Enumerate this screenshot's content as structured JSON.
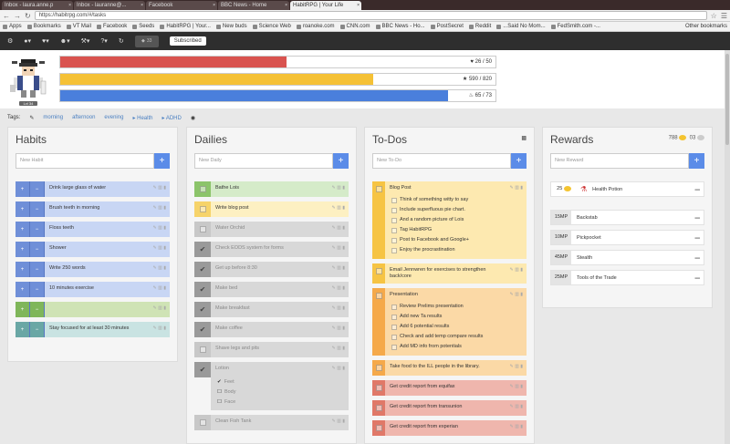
{
  "browser": {
    "tabs": [
      {
        "title": "Inbox - laura.anne.p",
        "active": false
      },
      {
        "title": "Inbox - lauranne@...",
        "active": false
      },
      {
        "title": "Facebook",
        "active": false
      },
      {
        "title": "BBC News - Home",
        "active": false
      },
      {
        "title": "HabitRPG | Your Life",
        "active": true
      }
    ],
    "url": "https://habitrpg.com/#/tasks",
    "bookmarks": [
      "Apps",
      "Bookmarks",
      "VT Mail",
      "Facebook",
      "Seeds",
      "HabitRPG | Your...",
      "New buds",
      "Science Web",
      "roanoke.com",
      "CNN.com",
      "BBC News - Ho...",
      "PostSecret",
      "Reddit",
      "...Said No Mom...",
      "FedSmith.com -..."
    ],
    "other_bookmarks": "Other bookmarks"
  },
  "nav": {
    "gems_label": "33",
    "subscribed_label": "Subscribed"
  },
  "stats": {
    "level_badge": "Lvl 34",
    "health": {
      "label": "26 / 50",
      "value": 26,
      "max": 50,
      "color": "#d9534f"
    },
    "experience": {
      "label": "590 / 820",
      "value": 590,
      "max": 820,
      "color": "#f5c136"
    },
    "mana": {
      "label": "65 / 73",
      "value": 65,
      "max": 73,
      "color": "#4a7fdc"
    }
  },
  "tags": {
    "label": "Tags:",
    "items": [
      "morning",
      "afternoon",
      "evening",
      "Health",
      "ADHD"
    ]
  },
  "habits": {
    "title": "Habits",
    "placeholder": "New Habit",
    "items": [
      {
        "text": "Drink large glass of water",
        "color": "#c8d6f4"
      },
      {
        "text": "Brush teeth in morning",
        "color": "#c8d6f4"
      },
      {
        "text": "Floss teeth",
        "color": "#c8d6f4"
      },
      {
        "text": "Shower",
        "color": "#c8d6f4"
      },
      {
        "text": "Write 250 words",
        "color": "#c8d6f4"
      },
      {
        "text": "10 minutes exercise",
        "color": "#c8d6f4"
      },
      {
        "text": "",
        "color": "#cfe3b5"
      },
      {
        "text": "Stay focused for at least 30 minutes",
        "color": "#c9e3e2"
      }
    ]
  },
  "dailies": {
    "title": "Dailies",
    "placeholder": "New Daily",
    "items": [
      {
        "text": "Bathe Lois",
        "color": "#d5ebc9",
        "done": false
      },
      {
        "text": "Write blog post",
        "color": "#fdf0c2",
        "done": false
      },
      {
        "text": "Water Orchid",
        "color": "#d8d8d8",
        "done": false
      },
      {
        "text": "Check EODS system for forms",
        "color": "#d8d8d8",
        "done": true
      },
      {
        "text": "Get up before 8:30",
        "color": "#d8d8d8",
        "done": true
      },
      {
        "text": "Make bed",
        "color": "#d8d8d8",
        "done": true
      },
      {
        "text": "Make breakfast",
        "color": "#d8d8d8",
        "done": true
      },
      {
        "text": "Make coffee",
        "color": "#d8d8d8",
        "done": true
      },
      {
        "text": "Shave legs and pits",
        "color": "#d8d8d8",
        "done": false
      },
      {
        "text": "Lotion",
        "color": "#d8d8d8",
        "done": true,
        "sub": [
          "Feet",
          "Body",
          "Face"
        ]
      },
      {
        "text": "Clean Fish Tank",
        "color": "#d8d8d8",
        "done": false
      }
    ]
  },
  "todos": {
    "title": "To-Dos",
    "placeholder": "New To-Do",
    "items": [
      {
        "text": "Blog Post",
        "color": "#fde9b0",
        "ctrl": "#f6c444",
        "sub": [
          "Think of something witty to say",
          "Include superfluous pie chart.",
          "And a random picture of Lois",
          "Tag HabitRPG",
          "Post to Facebook and Google+",
          "Enjoy the procrastination"
        ]
      },
      {
        "text": "Email Jennwren for exercises to strengthen back/core",
        "color": "#fde9b0",
        "ctrl": "#f6c444",
        "sub": []
      },
      {
        "text": "Presentation",
        "color": "#fbd9a6",
        "ctrl": "#f5a94a",
        "sub": [
          "Review Prelims presentation",
          "Add new Ta results",
          "Add 6 potential results",
          "Check and add temp compare results",
          "Add MD info from potentials"
        ]
      },
      {
        "text": "Take food to the ILL people in the library.",
        "color": "#fbd9a6",
        "ctrl": "#f5a94a",
        "sub": []
      },
      {
        "text": "Get credit report from equifax",
        "color": "#efb6ad",
        "ctrl": "#e07868",
        "sub": []
      },
      {
        "text": "Get credit report from transunion",
        "color": "#efb6ad",
        "ctrl": "#e07868",
        "sub": []
      },
      {
        "text": "Get credit report from experian",
        "color": "#efb6ad",
        "ctrl": "#e07868",
        "sub": []
      }
    ]
  },
  "rewards": {
    "title": "Rewards",
    "gold": "788",
    "silver": "03",
    "placeholder": "New Reward",
    "items": [
      {
        "cost": "25",
        "name": "Health Potion",
        "coin": true
      },
      {
        "cost": "15MP",
        "name": "Backstab",
        "coin": false
      },
      {
        "cost": "10MP",
        "name": "Pickpocket",
        "coin": false
      },
      {
        "cost": "45MP",
        "name": "Stealth",
        "coin": false
      },
      {
        "cost": "25MP",
        "name": "Tools of the Trade",
        "coin": false
      }
    ]
  }
}
